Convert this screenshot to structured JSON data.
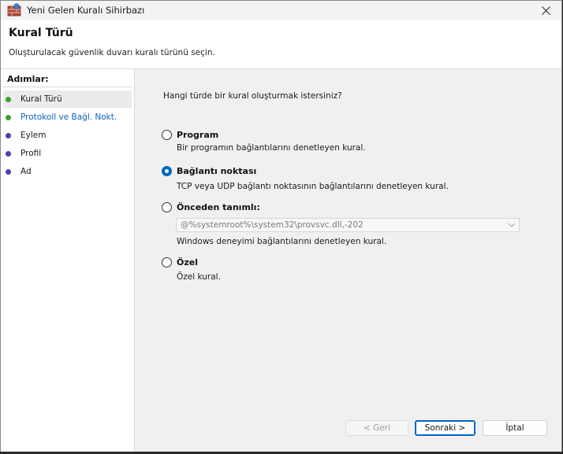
{
  "window": {
    "title": "Yeni Gelen Kuralı Sihirbazı"
  },
  "header": {
    "title": "Kural Türü",
    "description": "Oluşturulacak güvenlik duvarı kuralı türünü seçin."
  },
  "sidebar": {
    "heading": "Adımlar:",
    "steps": [
      {
        "label": "Kural Türü",
        "dot_color": "#3aa12f",
        "state": "current"
      },
      {
        "label": "Protokoll ve Bağl. Nokt.",
        "dot_color": "#3aa12f",
        "state": "link"
      },
      {
        "label": "Eylem",
        "dot_color": "#4b3fb5",
        "state": "pending"
      },
      {
        "label": "Profil",
        "dot_color": "#4b3fb5",
        "state": "pending"
      },
      {
        "label": "Ad",
        "dot_color": "#4b3fb5",
        "state": "pending"
      }
    ]
  },
  "main": {
    "question": "Hangi türde bir kural oluşturmak istersiniz?",
    "options": [
      {
        "label": "Program",
        "description": "Bir programın bağlantılarını denetleyen kural.",
        "checked": false
      },
      {
        "label": "Bağlantı noktası",
        "description": "TCP veya UDP bağlantı noktasının bağlantılarını denetleyen kural.",
        "checked": true
      },
      {
        "label": "Önceden tanımlı:",
        "description": "Windows deneyimi bağlantılarını denetleyen kural.",
        "checked": false
      },
      {
        "label": "Özel",
        "description": "Özel kural.",
        "checked": false
      }
    ],
    "predefined_combo": {
      "value": "@%systemroot%\\system32\\provsvc.dll,-202",
      "disabled": true
    }
  },
  "buttons": {
    "back": "< Geri",
    "next": "Sonraki >",
    "cancel": "İptal"
  }
}
